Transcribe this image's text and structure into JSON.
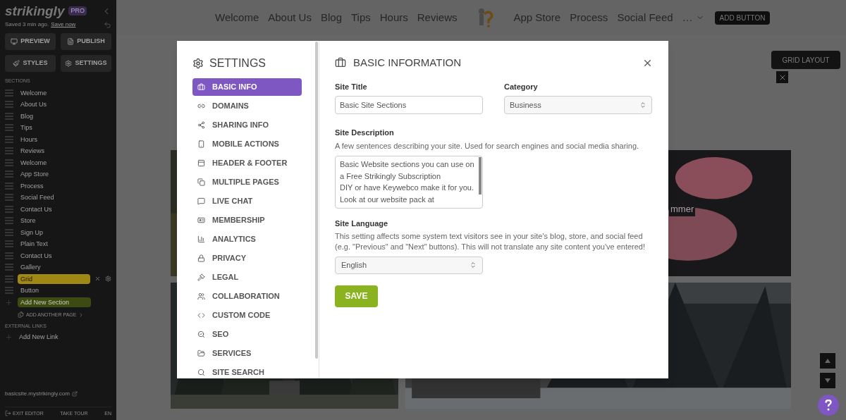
{
  "sidebar": {
    "brand": "strikingly",
    "badge": "PRO",
    "save_status": "Saved 3 min ago.",
    "save_link": "Save now",
    "buttons": [
      {
        "label": "PREVIEW"
      },
      {
        "label": "PUBLISH"
      },
      {
        "label": "STYLES"
      },
      {
        "label": "SETTINGS"
      }
    ],
    "sections_heading": "SECTIONS",
    "sections": [
      {
        "label": "Welcome",
        "selected": false
      },
      {
        "label": "About Us",
        "selected": false
      },
      {
        "label": "Blog",
        "selected": false
      },
      {
        "label": "Tips",
        "selected": false
      },
      {
        "label": "Hours",
        "selected": false
      },
      {
        "label": "Reviews",
        "selected": false
      },
      {
        "label": "Welcome",
        "selected": false
      },
      {
        "label": "App Store",
        "selected": false
      },
      {
        "label": "Process",
        "selected": false
      },
      {
        "label": "Social Feed",
        "selected": false
      },
      {
        "label": "Contact Us",
        "selected": false
      },
      {
        "label": "Store",
        "selected": false
      },
      {
        "label": "Sign Up",
        "selected": false
      },
      {
        "label": "Plain Text",
        "selected": false
      },
      {
        "label": "Contact Us",
        "selected": false
      },
      {
        "label": "Gallery",
        "selected": false
      },
      {
        "label": "Grid",
        "selected": true
      },
      {
        "label": "Button",
        "selected": false
      }
    ],
    "add_section": "Add New Section",
    "add_page": "ADD ANOTHER PAGE",
    "external_heading": "EXTERNAL LINKS",
    "add_link": "Add New Link",
    "site_url": "basicsite.mystrikingly.com",
    "footer": [
      "EXIT EDITOR",
      "TAKE TOUR",
      "EN"
    ]
  },
  "nav": {
    "left_items": [
      "Welcome",
      "About Us",
      "Blog",
      "Tips",
      "Hours",
      "Reviews"
    ],
    "right_items": [
      "App Store",
      "Process",
      "Social Feed"
    ],
    "more": "…",
    "add_button": "ADD BUTTON"
  },
  "canvas": {
    "grid_layout_button": "GRID LAYOUT",
    "caption": "mmer"
  },
  "modal": {
    "title": "SETTINGS",
    "menu": [
      {
        "label": "BASIC INFO",
        "selected": true
      },
      {
        "label": "DOMAINS",
        "selected": false
      },
      {
        "label": "SHARING INFO",
        "selected": false
      },
      {
        "label": "MOBILE ACTIONS",
        "selected": false
      },
      {
        "label": "HEADER & FOOTER",
        "selected": false
      },
      {
        "label": "MULTIPLE PAGES",
        "selected": false
      },
      {
        "label": "LIVE CHAT",
        "selected": false
      },
      {
        "label": "MEMBERSHIP",
        "selected": false
      },
      {
        "label": "ANALYTICS",
        "selected": false
      },
      {
        "label": "PRIVACY",
        "selected": false
      },
      {
        "label": "LEGAL",
        "selected": false
      },
      {
        "label": "COLLABORATION",
        "selected": false
      },
      {
        "label": "CUSTOM CODE",
        "selected": false
      },
      {
        "label": "SEO",
        "selected": false
      },
      {
        "label": "SERVICES",
        "selected": false
      },
      {
        "label": "SITE SEARCH",
        "selected": false
      }
    ],
    "section_title": "BASIC INFORMATION",
    "site_title": {
      "label": "Site Title",
      "value": "Basic Site Sections"
    },
    "category": {
      "label": "Category",
      "value": "Business"
    },
    "description": {
      "label": "Site Description",
      "help": "A few sentences describing your site. Used for search engines and social media sharing.",
      "value": "Basic Website sections you can use on a Free Strikingly Subscription\nDIY or have Keywebco make it for you.\nLook at our website pack at"
    },
    "language": {
      "label": "Site Language",
      "help": "This setting affects some system text visitors see in your site's blog, store, and social feed (e.g. \"Previous\" and \"Next\" buttons). This will not translate any site content you've entered!",
      "value": "English"
    },
    "save": "SAVE"
  }
}
